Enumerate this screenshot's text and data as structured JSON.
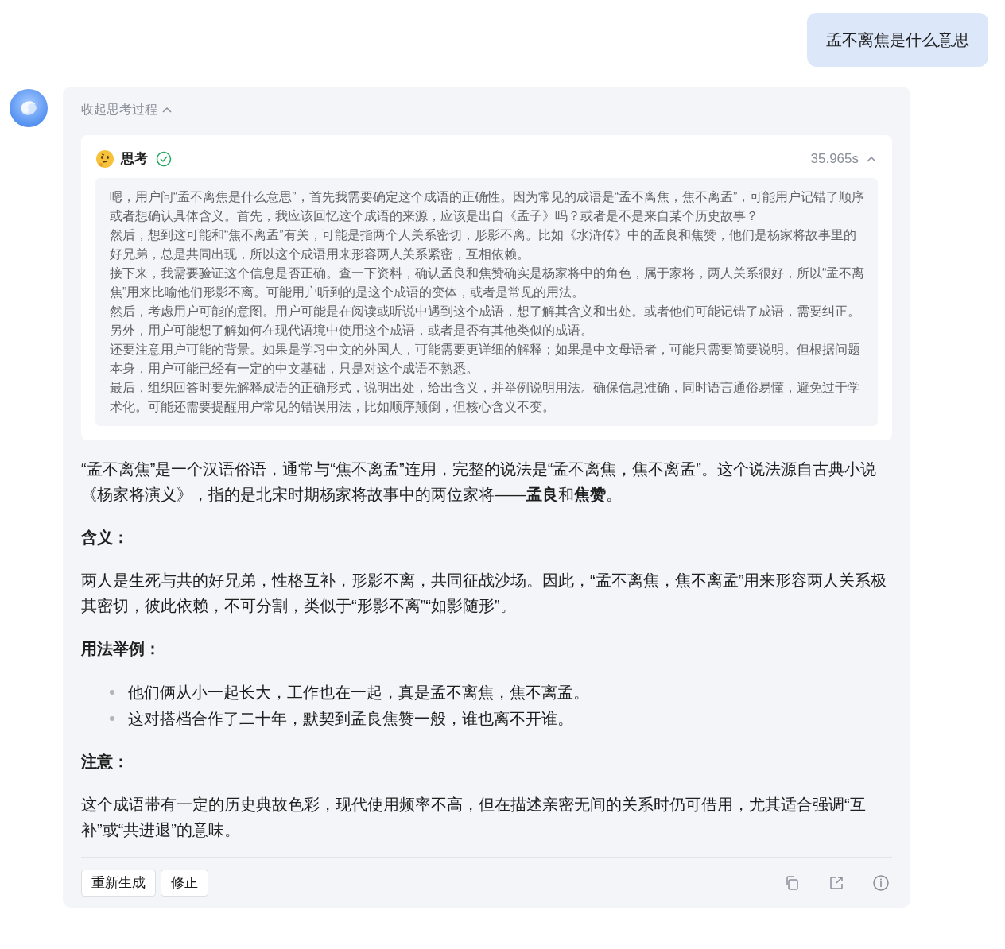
{
  "user_message": "孟不离焦是什么意思",
  "reasoning": {
    "toggle_label": "收起思考过程",
    "expanded": true,
    "title": "思考",
    "done": true,
    "duration": "35.965s",
    "paragraphs": [
      "嗯，用户问“孟不离焦是什么意思”，首先我需要确定这个成语的正确性。因为常见的成语是“孟不离焦，焦不离孟”，可能用户记错了顺序或者想确认具体含义。首先，我应该回忆这个成语的来源，应该是出自《孟子》吗？或者是不是来自某个历史故事？",
      "然后，想到这可能和“焦不离孟”有关，可能是指两个人关系密切，形影不离。比如《水浒传》中的孟良和焦赞，他们是杨家将故事里的好兄弟，总是共同出现，所以这个成语用来形容两人关系紧密，互相依赖。",
      "接下来，我需要验证这个信息是否正确。查一下资料，确认孟良和焦赞确实是杨家将中的角色，属于家将，两人关系很好，所以“孟不离焦”用来比喻他们形影不离。可能用户听到的是这个成语的变体，或者是常见的用法。",
      "然后，考虑用户可能的意图。用户可能是在阅读或听说中遇到这个成语，想了解其含义和出处。或者他们可能记错了成语，需要纠正。另外，用户可能想了解如何在现代语境中使用这个成语，或者是否有其他类似的成语。",
      "还要注意用户可能的背景。如果是学习中文的外国人，可能需要更详细的解释；如果是中文母语者，可能只需要简要说明。但根据问题本身，用户可能已经有一定的中文基础，只是对这个成语不熟悉。",
      "最后，组织回答时要先解释成语的正确形式，说明出处，给出含义，并举例说明用法。确保信息准确，同时语言通俗易懂，避免过于学术化。可能还需要提醒用户常见的错误用法，比如顺序颠倒，但核心含义不变。"
    ]
  },
  "answer": [
    {
      "kind": "paragraph",
      "text": "“孟不离焦”是一个汉语俗语，通常与“焦不离孟”连用，完整的说法是“孟不离焦，焦不离孟”。这个说法源自古典小说《杨家将演义》，指的是北宋时期杨家将故事中的两位家将——**孟良**和**焦赞**。"
    },
    {
      "kind": "heading",
      "text": "含义："
    },
    {
      "kind": "paragraph",
      "text": "两人是生死与共的好兄弟，性格互补，形影不离，共同征战沙场。因此，“孟不离焦，焦不离孟”用来形容两人关系极其密切，彼此依赖，不可分割，类似于“形影不离”“如影随形”。"
    },
    {
      "kind": "heading",
      "text": "用法举例："
    },
    {
      "kind": "list",
      "items": [
        "他们俩从小一起长大，工作也在一起，真是孟不离焦，焦不离孟。",
        "这对搭档合作了二十年，默契到孟良焦赞一般，谁也离不开谁。"
      ]
    },
    {
      "kind": "heading",
      "text": "注意："
    },
    {
      "kind": "paragraph",
      "text": "这个成语带有一定的历史典故色彩，现代使用频率不高，但在描述亲密无间的关系时仍可借用，尤其适合强调“互补”或“共进退”的意味。"
    }
  ],
  "actions": [
    "重新生成",
    "修正"
  ]
}
